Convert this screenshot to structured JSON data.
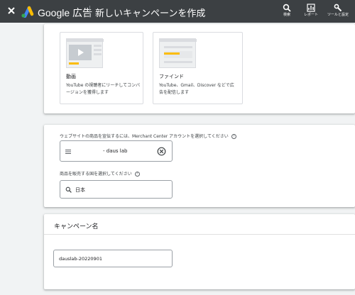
{
  "app": {
    "brand": "Google 広告",
    "page_title": "新しいキャンペーンを作成"
  },
  "toolbar": {
    "search_label": "検索",
    "reports_label": "レポート",
    "tools_label": "ツールと設定"
  },
  "subtypes": [
    {
      "name": "動画",
      "description": "YouTube の視聴者にリーチしてコンバージョンを獲得します"
    },
    {
      "name": "ファインド",
      "description": "YouTube、Gmail、Discover などで広告を配信します"
    }
  ],
  "merchant": {
    "label": "ウェブサイトの商品を宣伝するには、Merchant Center アカウントを選択してください",
    "account_value": "- daus lab"
  },
  "country": {
    "label": "商品を販売する国を選択してください",
    "value": "日本"
  },
  "campaign_name": {
    "title": "キャンペーン名",
    "value": "dauslab-20220901"
  },
  "colors": {
    "topbar": "#3c4043",
    "background": "#f1f3f4",
    "accent_yellow": "#fbbc04",
    "google_blue": "#4285f4"
  }
}
